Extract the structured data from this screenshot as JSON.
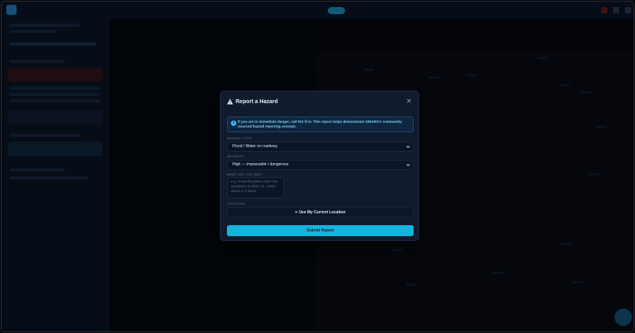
{
  "modal": {
    "title": "Report a Hazard",
    "title_icon": "warning-triangle-icon",
    "close_icon": "close-icon",
    "close_label": "✕",
    "alert": {
      "icon": "info-icon",
      "icon_glyph": "i",
      "text": "If you are in immediate danger, call 911 first. This report helps demonstrate UDIARS's community-sourced hazard reporting concept."
    },
    "hazard_type": {
      "label": "HAZARD TYPE",
      "selected": "Flood / Water on roadway"
    },
    "severity": {
      "label": "SEVERITY",
      "selected": "High — impassable / dangerous"
    },
    "description": {
      "label": "WHAT DID YOU SEE?",
      "placeholder": "e.g. Road flooded under the overpass at Main St, water about 1 ft deep"
    },
    "location": {
      "label": "LOCATION",
      "button_label": "Use My Current Location",
      "button_icon": "crosshair-icon",
      "button_glyph": "⌖"
    },
    "submit_label": "Submit Report"
  },
  "colors": {
    "accent": "#14b4dc",
    "modal_bg": "#111b2e",
    "alert_text": "#7fd0f5"
  }
}
